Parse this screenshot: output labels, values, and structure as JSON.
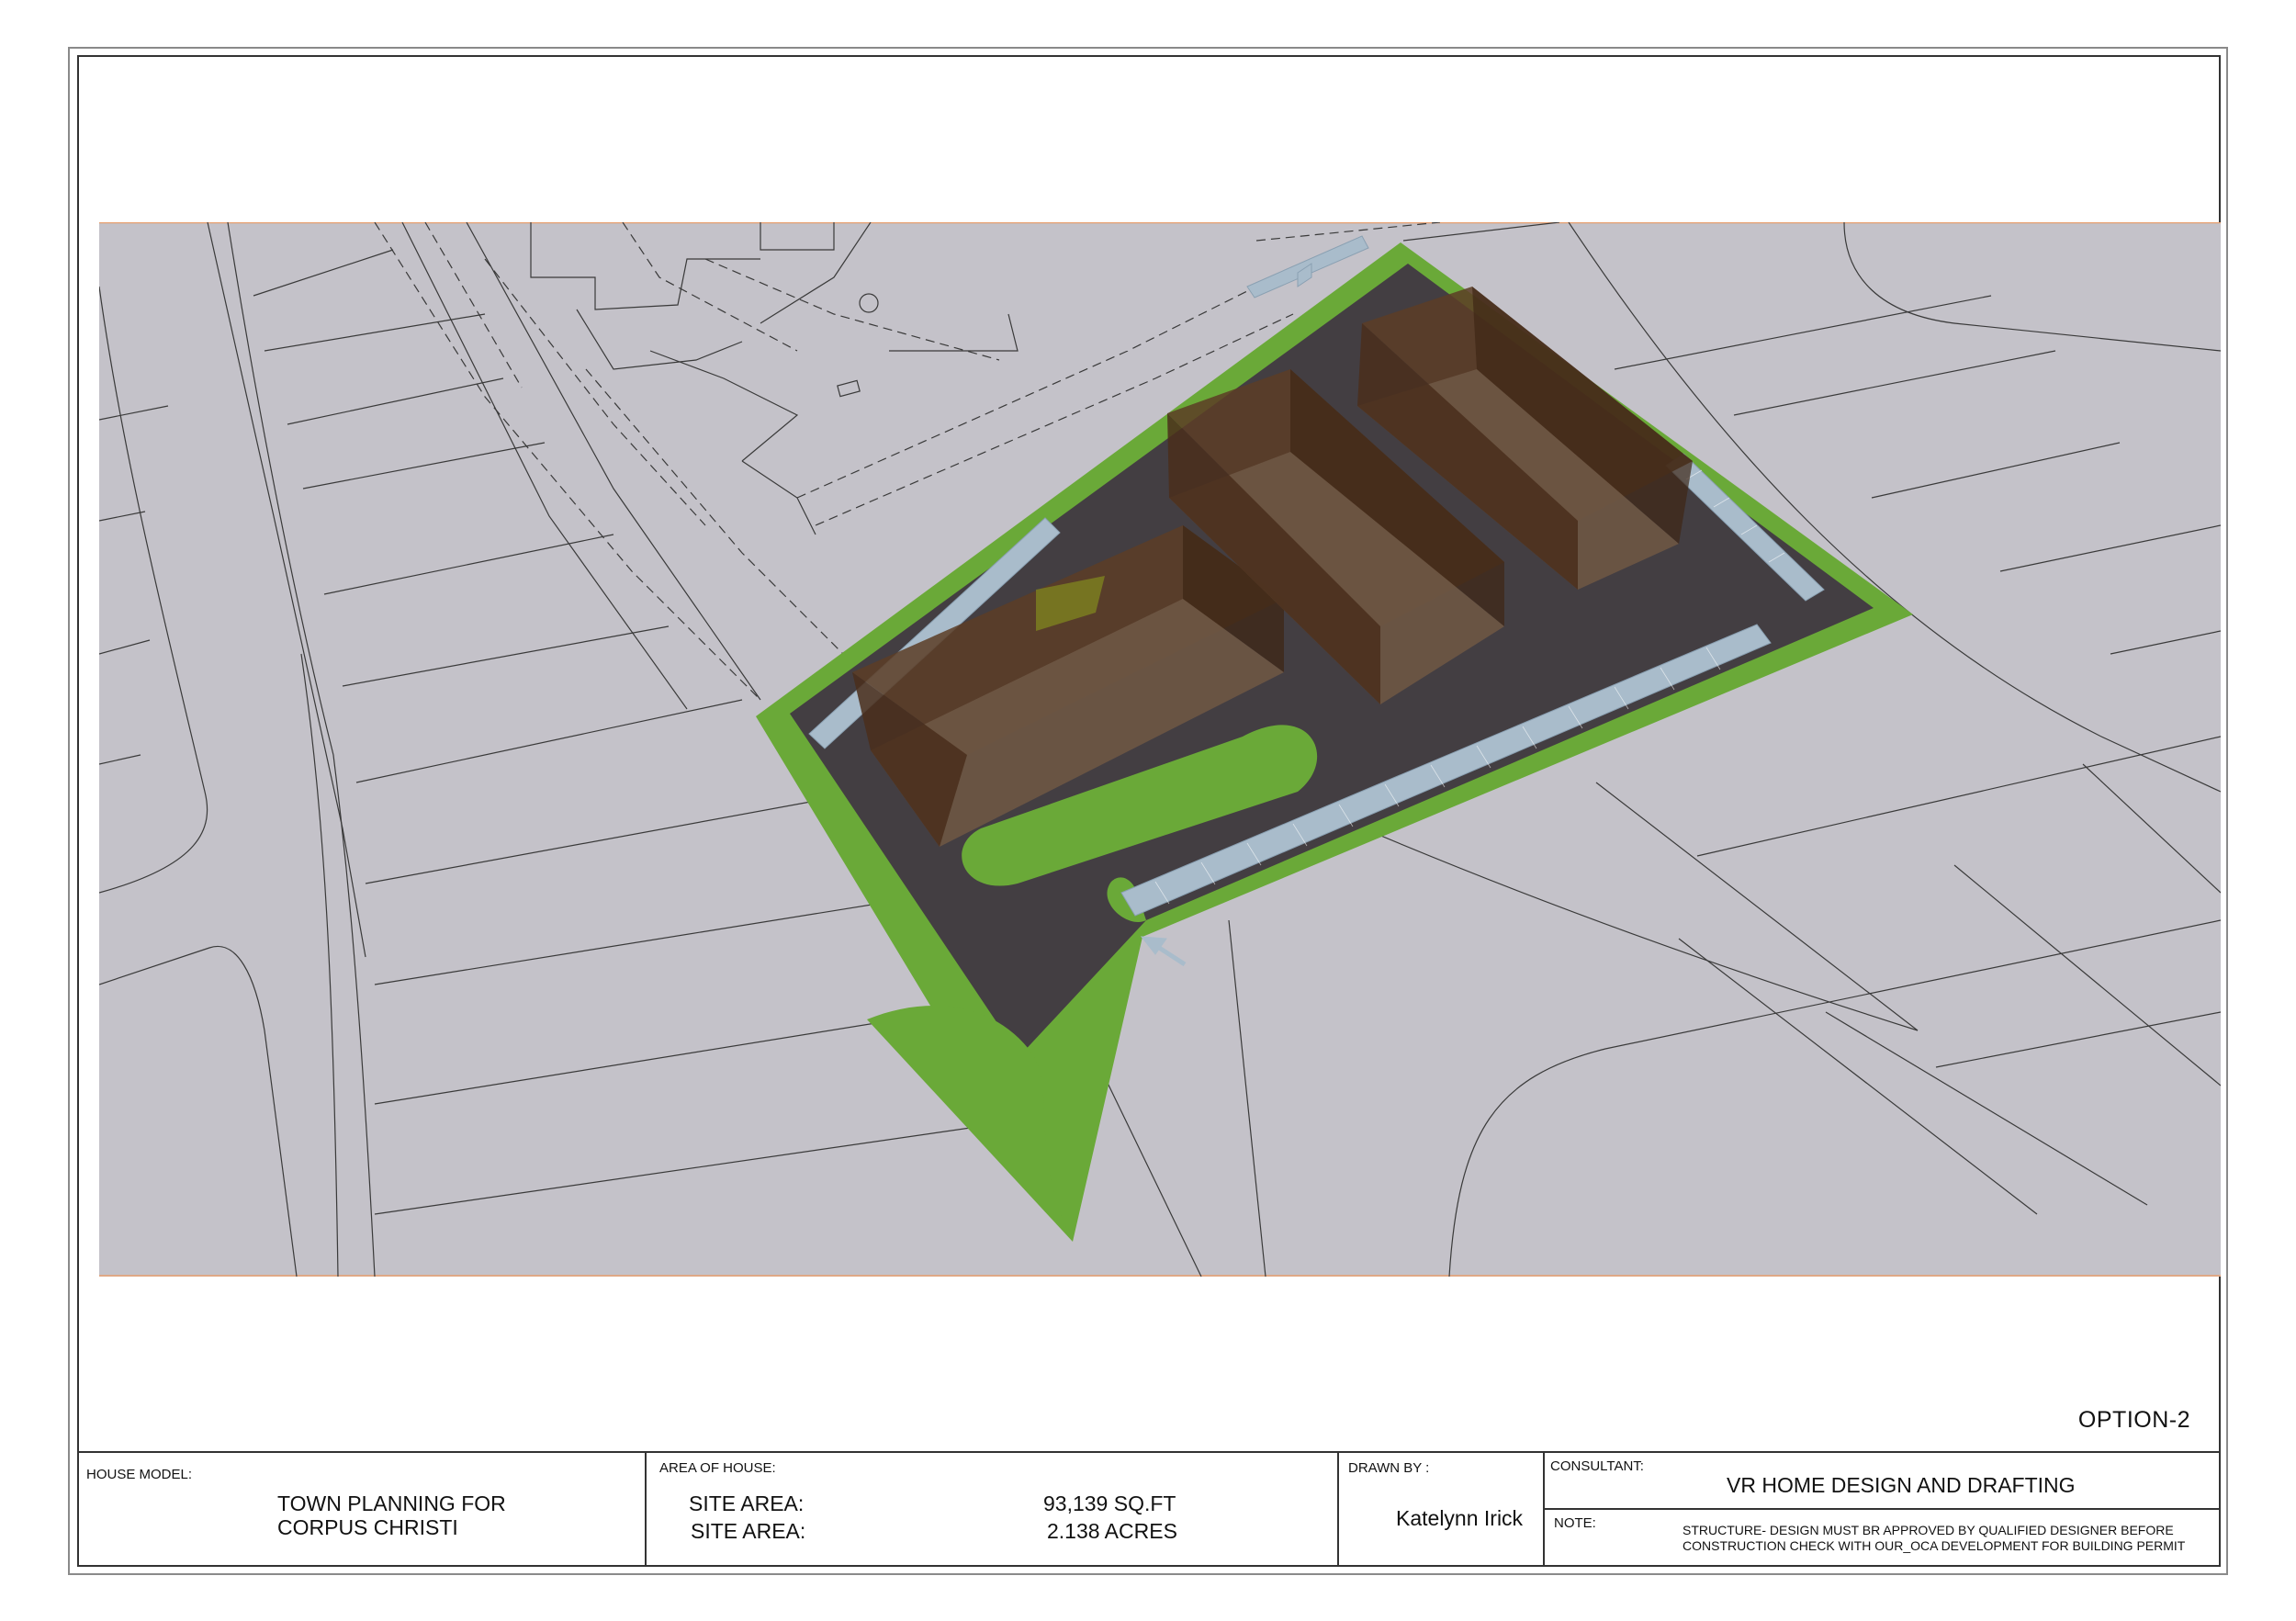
{
  "sheet": {
    "option_label": "OPTION-2"
  },
  "title_block": {
    "house_model_label": "HOUSE MODEL:",
    "house_model_line1": "TOWN PLANNING FOR",
    "house_model_line2": "CORPUS CHRISTI",
    "area_label": "AREA OF HOUSE:",
    "site_area_label_1": "SITE AREA:",
    "site_area_value_1": "93,139 SQ.FT",
    "site_area_label_2": "SITE AREA:",
    "site_area_value_2": "2.138 ACRES",
    "drawn_by_label": "DRAWN BY :",
    "drawn_by_name": "Katelynn Irick",
    "consultant_label": "CONSULTANT:",
    "consultant_name": "VR HOME DESIGN AND DRAFTING",
    "note_label": "NOTE:",
    "note_line1": "STRUCTURE- DESIGN MUST BR APPROVED BY QUALIFIED DESIGNER  BEFORE",
    "note_line2": "CONSTRUCTION CHECK WITH OUR_OCA  DEVELOPMENT FOR BUILDING PERMIT"
  },
  "colors": {
    "ground": "#c4c2c9",
    "lawn": "#6aa938",
    "pavement": "#433e42",
    "parking": "#a9bccb",
    "building": "#5c3d26"
  }
}
